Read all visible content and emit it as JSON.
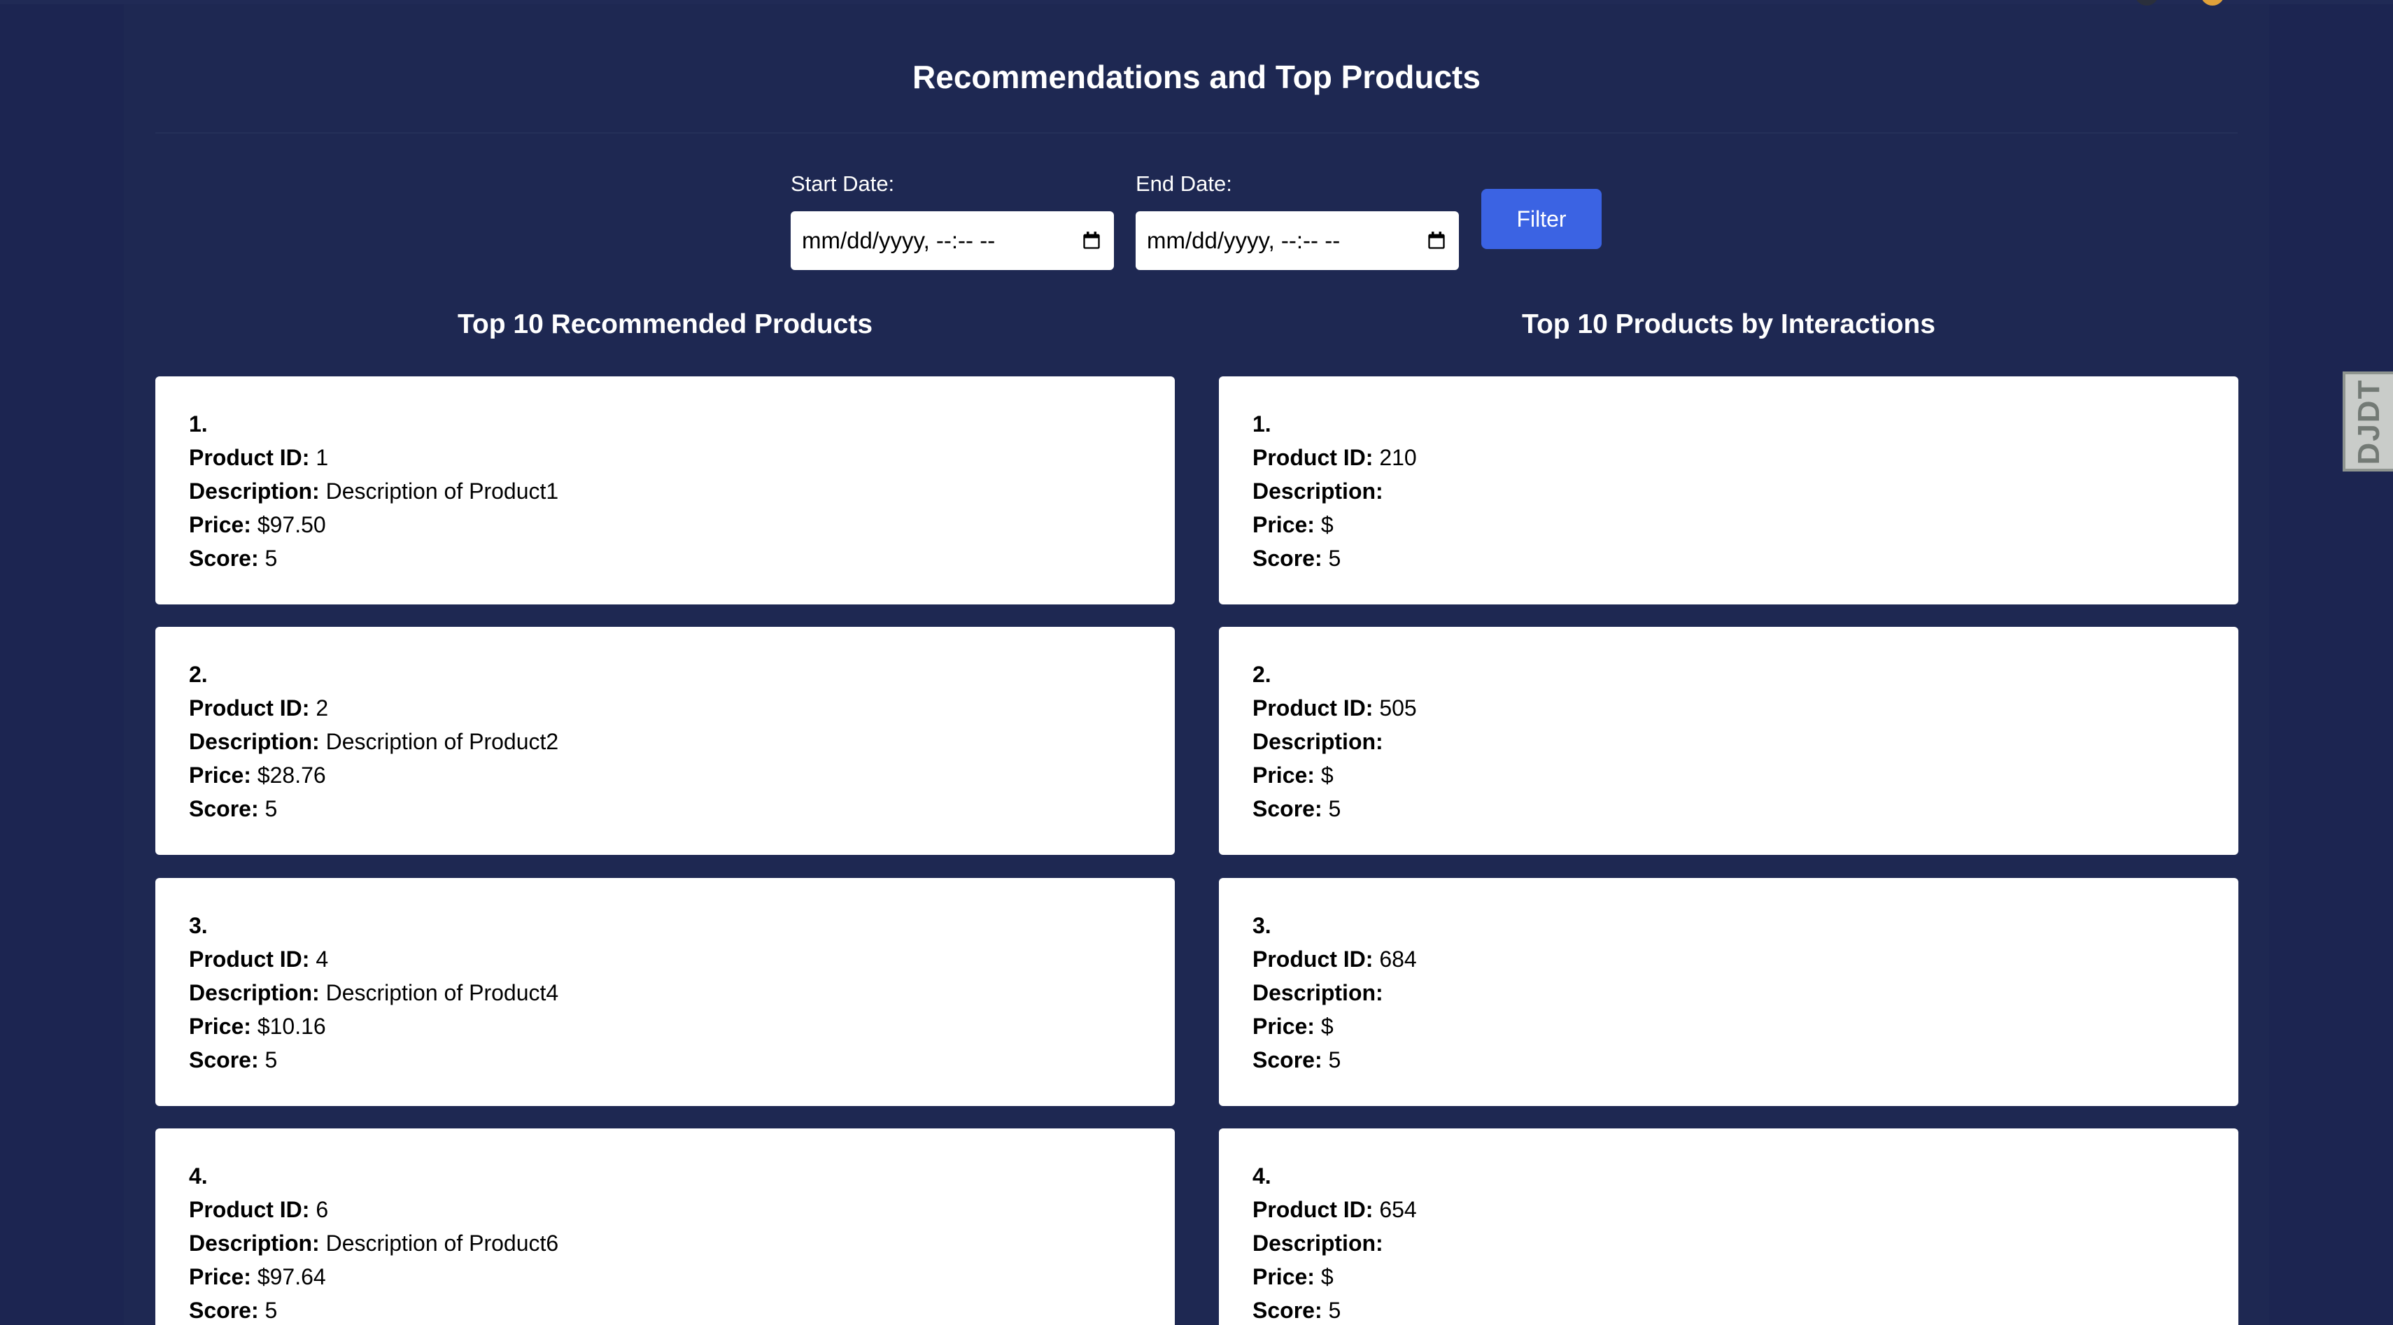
{
  "title": "Recommendations and Top Products",
  "filters": {
    "start_label": "Start Date:",
    "start_placeholder": "mm/dd/yyyy, --:-- --",
    "end_label": "End Date:",
    "end_placeholder": "mm/dd/yyyy, --:-- --",
    "filter_button": "Filter"
  },
  "field_labels": {
    "product_id": "Product ID:",
    "description": "Description:",
    "price": "Price:",
    "score": "Score:"
  },
  "recommended": {
    "heading": "Top 10 Recommended Products",
    "items": [
      {
        "rank": "1.",
        "product_id": "1",
        "description": "Description of Product1",
        "price": "$97.50",
        "score": "5"
      },
      {
        "rank": "2.",
        "product_id": "2",
        "description": "Description of Product2",
        "price": "$28.76",
        "score": "5"
      },
      {
        "rank": "3.",
        "product_id": "4",
        "description": "Description of Product4",
        "price": "$10.16",
        "score": "5"
      },
      {
        "rank": "4.",
        "product_id": "6",
        "description": "Description of Product6",
        "price": "$97.64",
        "score": "5"
      }
    ]
  },
  "interactions": {
    "heading": "Top 10 Products by Interactions",
    "items": [
      {
        "rank": "1.",
        "product_id": "210",
        "description": "",
        "price": "$",
        "score": "5"
      },
      {
        "rank": "2.",
        "product_id": "505",
        "description": "",
        "price": "$",
        "score": "5"
      },
      {
        "rank": "3.",
        "product_id": "684",
        "description": "",
        "price": "$",
        "score": "5"
      },
      {
        "rank": "4.",
        "product_id": "654",
        "description": "",
        "price": "$",
        "score": "5"
      }
    ]
  },
  "debug_toolbar": {
    "label": "DJDT"
  },
  "colors": {
    "background": "#1c2551",
    "accent": "#3b63e3",
    "card": "#ffffff"
  }
}
